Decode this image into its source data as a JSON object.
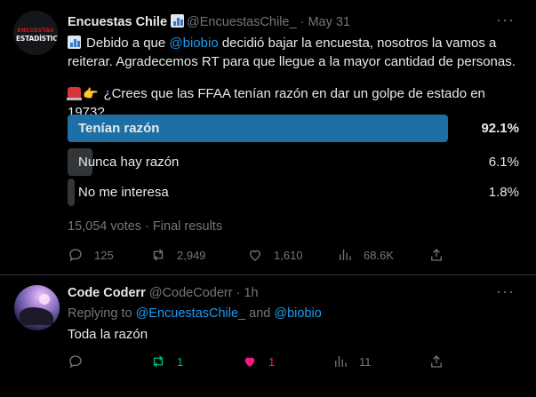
{
  "tweet1": {
    "avatar_lines": [
      "ENCUESTAS",
      "ESTADÍSTICAS"
    ],
    "name": "Encuestas Chile",
    "handle": "@EncuestasChile_",
    "dot": "·",
    "date": "May 31",
    "more": "···",
    "text_before": "Debido a que ",
    "mention": "@biobio",
    "text_after": " decidió bajar la encuesta, nosotros la vamos a reiterar. Agradecemos RT para que llegue a la mayor cantidad de personas.",
    "question": "¿Crees que las FFAA tenían razón en dar un golpe de estado en 1973?",
    "poll": [
      {
        "label": "Tenían razón",
        "percent": "92.1%",
        "fraction": 0.921,
        "winner": true
      },
      {
        "label": "Nunca hay razón",
        "percent": "6.1%",
        "fraction": 0.061,
        "winner": false
      },
      {
        "label": "No me interesa",
        "percent": "1.8%",
        "fraction": 0.018,
        "winner": false
      }
    ],
    "votes_summary": "15,054 votes · Final results",
    "counts": {
      "replies": "125",
      "retweets": "2,949",
      "likes": "1,610",
      "views": "68.6K"
    }
  },
  "tweet2": {
    "name": "Code Coderr",
    "handle": "@CodeCoderr",
    "dot": "·",
    "date": "1h",
    "more": "···",
    "replying_prefix": "Replying to ",
    "replying_user1": "@EncuestasChile_",
    "replying_and": " and ",
    "replying_user2": "@biobio",
    "text": "Toda la razón",
    "counts": {
      "retweets": "1",
      "likes": "1",
      "views": "11"
    }
  },
  "colors": {
    "accent": "#1d9bf0",
    "winner_bar": "#1d6fa5",
    "retweet_active": "#00ba7c",
    "like_active": "#f91880",
    "muted": "#71767b"
  }
}
